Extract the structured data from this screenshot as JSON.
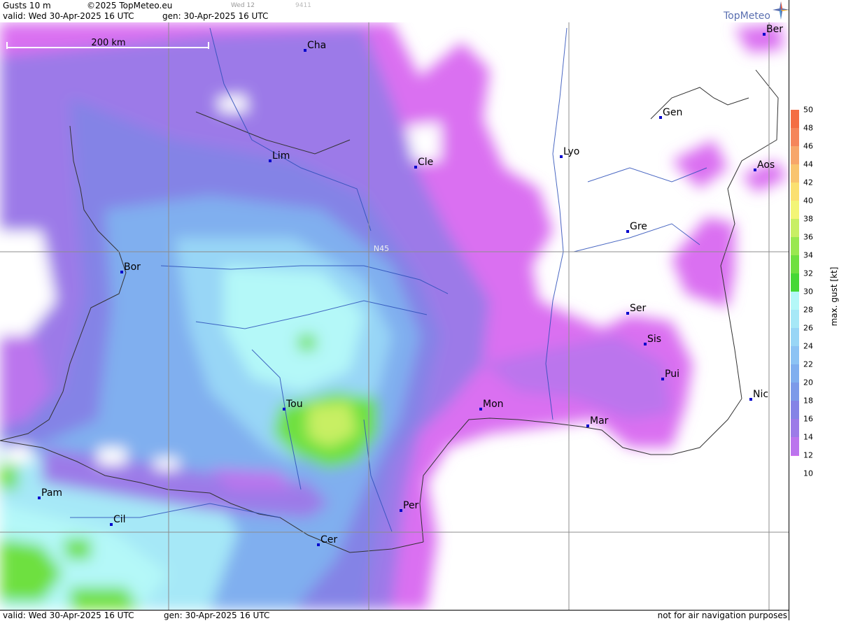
{
  "header": {
    "product": "Gusts 10 m",
    "copyright": "©2025 TopMeteo.eu",
    "valid": "valid:  Wed  30-Apr-2025  16 UTC",
    "generated": "gen: 30-Apr-2025 16 UTC",
    "run_day": "Wed 12",
    "code": "9411"
  },
  "footer": {
    "valid": "valid:  Wed  30-Apr-2025  16 UTC",
    "generated": "gen: 30-Apr-2025 16 UTC",
    "disclaimer": "not for air navigation purposes"
  },
  "logo": {
    "text": "TopMeteo"
  },
  "map": {
    "scale_label": "200 km",
    "lat_label": "N45",
    "cities": [
      {
        "name": "Cha"
      },
      {
        "name": "Ber"
      },
      {
        "name": "Gen"
      },
      {
        "name": "Lim"
      },
      {
        "name": "Lyo"
      },
      {
        "name": "Cle"
      },
      {
        "name": "Aos"
      },
      {
        "name": "Gre"
      },
      {
        "name": "Bor"
      },
      {
        "name": "Ser"
      },
      {
        "name": "Sis"
      },
      {
        "name": "Pui"
      },
      {
        "name": "Tou"
      },
      {
        "name": "Mon"
      },
      {
        "name": "Nic"
      },
      {
        "name": "Mar"
      },
      {
        "name": "Pam"
      },
      {
        "name": "Cil"
      },
      {
        "name": "Per"
      },
      {
        "name": "Cer"
      }
    ]
  },
  "legend": {
    "title": "max. gust [kt]",
    "ticks": [
      "50",
      "48",
      "46",
      "44",
      "42",
      "40",
      "38",
      "36",
      "34",
      "32",
      "30",
      "28",
      "26",
      "24",
      "22",
      "20",
      "18",
      "16",
      "14",
      "12",
      "10"
    ],
    "colors": {
      "50": "#f46d43",
      "48": "#f5855a",
      "46": "#f7a66a",
      "44": "#f9c46e",
      "42": "#fbe070",
      "40": "#f3f576",
      "38": "#c8ef64",
      "36": "#99e84f",
      "34": "#6ee03f",
      "32": "#45d835",
      "30": "#b4f8f8",
      "28": "#a6e8f7",
      "26": "#98d6f6",
      "24": "#8cc3f4",
      "22": "#80afef",
      "20": "#7c9ae9",
      "18": "#8483e6",
      "16": "#9c7ae8",
      "14": "#bb74ed",
      "12": "#da6ff1"
    }
  }
}
